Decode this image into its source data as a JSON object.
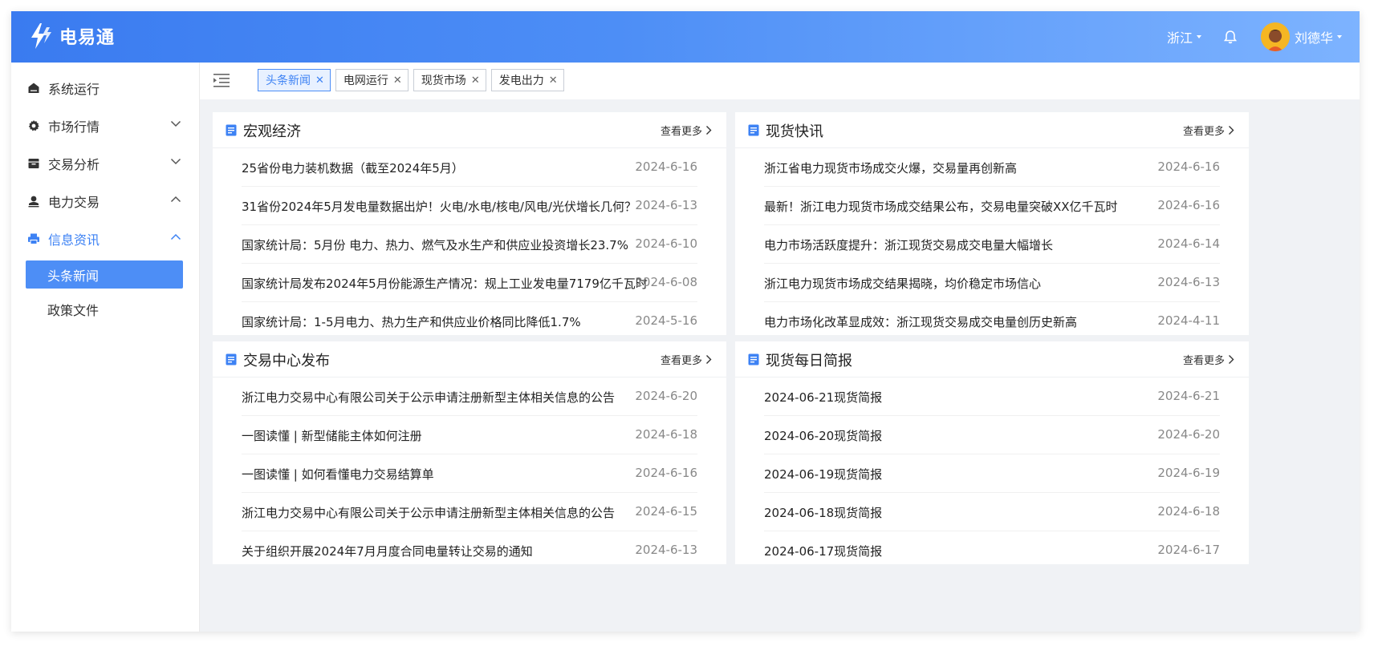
{
  "app": {
    "name": "电易通"
  },
  "header": {
    "region": "浙江",
    "username": "刘德华"
  },
  "sidebar": {
    "items": [
      {
        "label": "系统运行"
      },
      {
        "label": "市场行情"
      },
      {
        "label": "交易分析"
      },
      {
        "label": "电力交易"
      },
      {
        "label": "信息资讯"
      }
    ],
    "subitems": [
      {
        "label": "头条新闻"
      },
      {
        "label": "政策文件"
      }
    ]
  },
  "tabs": [
    {
      "label": "头条新闻"
    },
    {
      "label": "电网运行"
    },
    {
      "label": "现货市场"
    },
    {
      "label": "发电出力"
    }
  ],
  "more_label": "查看更多",
  "panels": [
    {
      "title": "宏观经济",
      "rows": [
        {
          "title": "25省份电力装机数据（截至2024年5月）",
          "date": "2024-6-16"
        },
        {
          "title": "31省份2024年5月发电量数据出炉！火电/水电/核电/风电/光伏增长几何？",
          "date": "2024-6-13"
        },
        {
          "title": "国家统计局：5月份 电力、热力、燃气及水生产和供应业投资增长23.7%",
          "date": "2024-6-10"
        },
        {
          "title": "国家统计局发布2024年5月份能源生产情况：规上工业发电量7179亿千瓦时",
          "date": "2024-6-08"
        },
        {
          "title": "国家统计局：1-5月电力、热力生产和供应业价格同比降低1.7%",
          "date": "2024-5-16"
        }
      ]
    },
    {
      "title": "现货快讯",
      "rows": [
        {
          "title": "浙江省电力现货市场成交火爆，交易量再创新高",
          "date": "2024-6-16"
        },
        {
          "title": "最新！浙江电力现货市场成交结果公布，交易电量突破XX亿千瓦时",
          "date": "2024-6-16"
        },
        {
          "title": "电力市场活跃度提升：浙江现货交易成交电量大幅增长",
          "date": "2024-6-14"
        },
        {
          "title": "浙江电力现货市场成交结果揭晓，均价稳定市场信心",
          "date": "2024-6-13"
        },
        {
          "title": "电力市场化改革显成效：浙江现货交易成交电量创历史新高",
          "date": "2024-4-11"
        }
      ]
    },
    {
      "title": "交易中心发布",
      "rows": [
        {
          "title": "浙江电力交易中心有限公司关于公示申请注册新型主体相关信息的公告",
          "date": "2024-6-20"
        },
        {
          "title": "一图读懂 | 新型储能主体如何注册",
          "date": "2024-6-18"
        },
        {
          "title": "一图读懂 | 如何看懂电力交易结算单",
          "date": "2024-6-16"
        },
        {
          "title": "浙江电力交易中心有限公司关于公示申请注册新型主体相关信息的公告",
          "date": "2024-6-15"
        },
        {
          "title": "关于组织开展2024年7月月度合同电量转让交易的通知",
          "date": "2024-6-13"
        }
      ]
    },
    {
      "title": "现货每日简报",
      "rows": [
        {
          "title": "2024-06-21现货简报",
          "date": "2024-6-21"
        },
        {
          "title": "2024-06-20现货简报",
          "date": "2024-6-20"
        },
        {
          "title": "2024-06-19现货简报",
          "date": "2024-6-19"
        },
        {
          "title": "2024-06-18现货简报",
          "date": "2024-6-18"
        },
        {
          "title": "2024-06-17现货简报",
          "date": "2024-6-17"
        }
      ]
    }
  ]
}
